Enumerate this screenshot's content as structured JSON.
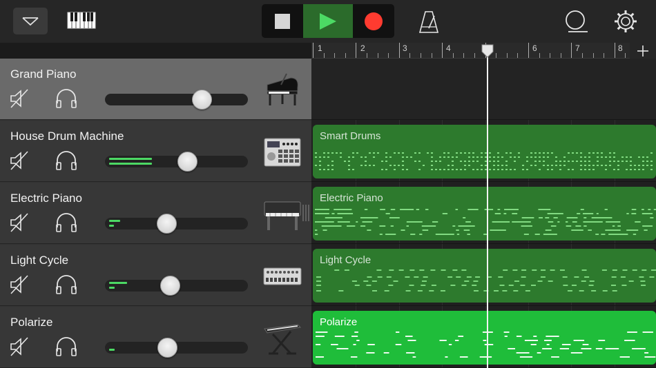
{
  "toolbar": {
    "menu_icon": "triangle-down-icon",
    "keyboard_icon": "keyboard-icon",
    "stop_icon": "stop-icon",
    "play_icon": "play-icon",
    "record_icon": "record-icon",
    "metronome_icon": "metronome-icon",
    "loop_icon": "loop-browser-icon",
    "settings_icon": "gear-icon",
    "colors": {
      "play_active": "#2b6b2b",
      "play_glyph": "#4cd964",
      "record": "#ff3b30"
    }
  },
  "ruler": {
    "bars": [
      "1",
      "2",
      "3",
      "4",
      "5",
      "6",
      "7",
      "8"
    ],
    "add_icon": "plus-icon"
  },
  "tracks": [
    {
      "name": "Grand Piano",
      "instrument_icon": "grand-piano-icon",
      "selected": true,
      "volume": 0.68
    },
    {
      "name": "House Drum Machine",
      "instrument_icon": "drum-machine-icon",
      "selected": false,
      "volume": 0.57
    },
    {
      "name": "Electric Piano",
      "instrument_icon": "electric-piano-icon",
      "selected": false,
      "volume": 0.43
    },
    {
      "name": "Light Cycle",
      "instrument_icon": "synth-module-icon",
      "selected": false,
      "volume": 0.46
    },
    {
      "name": "Polarize",
      "instrument_icon": "keyboard-stand-icon",
      "selected": false,
      "volume": 0.44
    }
  ],
  "regions": [
    {
      "label": "Smart Drums",
      "style": "dark"
    },
    {
      "label": "Electric Piano",
      "style": "dark"
    },
    {
      "label": "Light Cycle",
      "style": "dark"
    },
    {
      "label": "Polarize",
      "style": "bright"
    }
  ],
  "playhead_bar": 5
}
